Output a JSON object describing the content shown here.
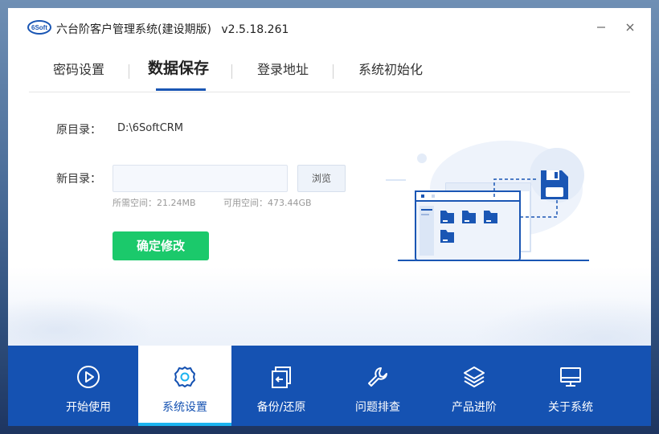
{
  "window": {
    "logo_text": "6Soft",
    "title": "六台阶客户管理系统(建设期版)",
    "version": "v2.5.18.261"
  },
  "tabs": [
    {
      "label": "密码设置",
      "active": false
    },
    {
      "label": "数据保存",
      "active": true
    },
    {
      "label": "登录地址",
      "active": false
    },
    {
      "label": "系统初始化",
      "active": false
    }
  ],
  "form": {
    "orig_dir_label": "原目录：",
    "orig_dir_value": "D:\\6SoftCRM",
    "new_dir_label": "新目录：",
    "new_dir_value": "",
    "new_dir_placeholder": "",
    "browse_label": "浏览",
    "required_space": "所需空间：21.24MB",
    "available_space": "可用空间：473.44GB",
    "confirm_label": "确定修改"
  },
  "bottom_nav": [
    {
      "label": "开始使用",
      "icon": "play-icon",
      "active": false
    },
    {
      "label": "系统设置",
      "icon": "gear-icon",
      "active": true
    },
    {
      "label": "备份/还原",
      "icon": "backup-restore-icon",
      "active": false
    },
    {
      "label": "问题排查",
      "icon": "wrench-icon",
      "active": false
    },
    {
      "label": "产品进阶",
      "icon": "layers-icon",
      "active": false
    },
    {
      "label": "关于系统",
      "icon": "monitor-icon",
      "active": false
    }
  ],
  "colors": {
    "accent": "#1552b2",
    "confirm": "#1bc96b",
    "tab_underline": "#1a56b4"
  }
}
